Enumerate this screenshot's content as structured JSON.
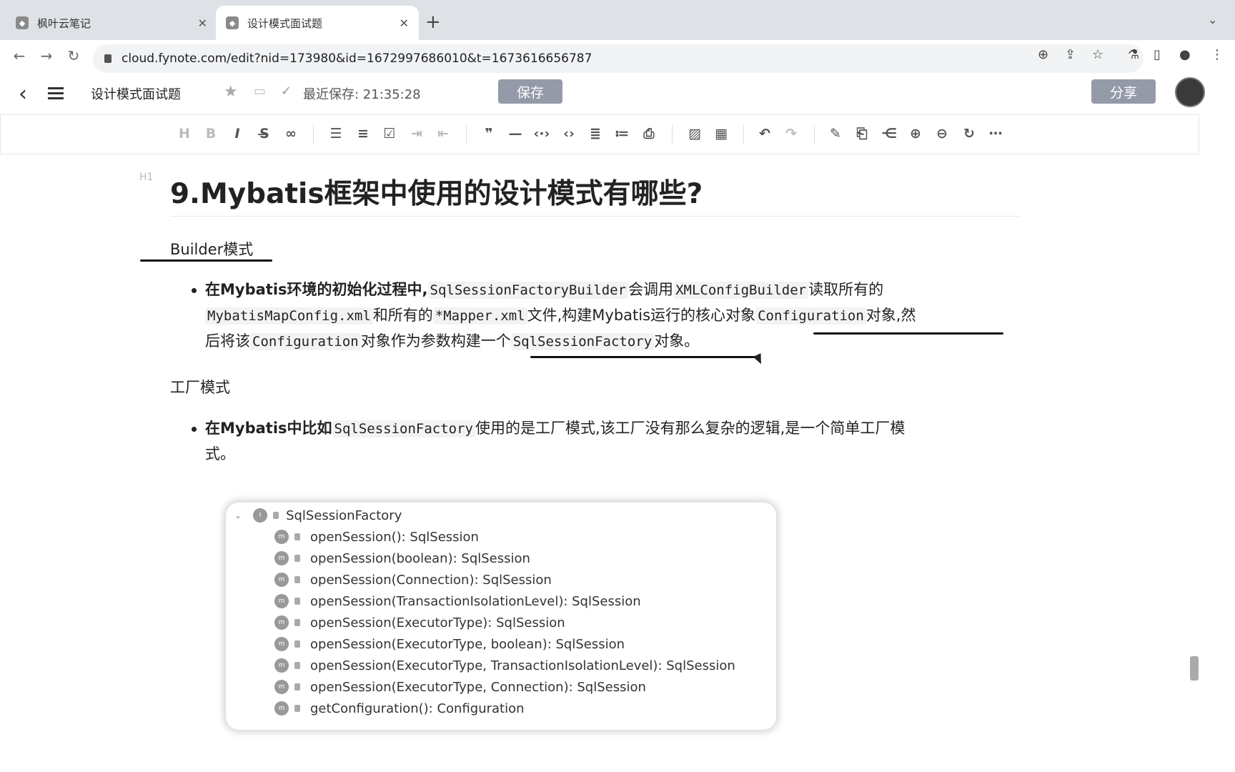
{
  "browser": {
    "tabs": [
      {
        "title": "枫叶云笔记",
        "active": false
      },
      {
        "title": "设计模式面试题",
        "active": true
      }
    ],
    "new_tab": "+",
    "url": "cloud.fynote.com/edit?nid=173980&id=1672997686010&t=1673616656787"
  },
  "header": {
    "doc_title": "设计模式面试题",
    "save_status": "最近保存: 21:35:28",
    "save_label": "保存",
    "share_label": "分享"
  },
  "toolbar_icons": [
    "heading-icon",
    "bold-icon",
    "italic-icon",
    "strikethrough-icon",
    "link-icon",
    "bullet-list-icon",
    "numbered-list-icon",
    "checklist-icon",
    "indent-icon",
    "outdent-icon",
    "quote-icon",
    "hr-icon",
    "inline-code-icon",
    "code-block-icon",
    "align-icon",
    "format-icon",
    "export-icon",
    "image-icon",
    "table-icon",
    "undo-icon",
    "redo-icon",
    "pen-icon",
    "ppt-icon",
    "mindmap-icon",
    "zoom-in-icon",
    "zoom-out-icon",
    "refresh-icon",
    "more-icon"
  ],
  "doc": {
    "h1_tag": "H1",
    "h1": "9.Mybatis框架中使用的设计模式有哪些?",
    "sec1": "Builder模式",
    "b1": {
      "l1a": "在Mybatis环境的初始化过程中,",
      "l1b": "SqlSessionFactoryBuilder",
      "l1c": "会调用",
      "l1d": "XMLConfigBuilder",
      "l1e": "读取所有的",
      "l2a": "MybatisMapConfig.xml",
      "l2b": "和所有的",
      "l2c": "*Mapper.xml",
      "l2d": "文件,构建Mybatis运行的核心对象",
      "l2e": "Configuration",
      "l2f": "对象,然",
      "l3a": "后将该",
      "l3b": "Configuration",
      "l3c": "对象作为参数构建一个",
      "l3d": "SqlSessionFactory",
      "l3e": "对象。"
    },
    "sec2": "工厂模式",
    "b2": {
      "l1a": "在Mybatis中比如",
      "l1b": "SqlSessionFactory",
      "l1c": "使用的是工厂模式,该工厂没有那么复杂的逻辑,是一个简单工厂模",
      "l2": "式。"
    },
    "figure": {
      "root": "SqlSessionFactory",
      "methods": [
        "openSession(): SqlSession",
        "openSession(boolean): SqlSession",
        "openSession(Connection): SqlSession",
        "openSession(TransactionIsolationLevel): SqlSession",
        "openSession(ExecutorType): SqlSession",
        "openSession(ExecutorType, boolean): SqlSession",
        "openSession(ExecutorType, TransactionIsolationLevel): SqlSession",
        "openSession(ExecutorType, Connection): SqlSession",
        "getConfiguration(): Configuration"
      ]
    }
  }
}
